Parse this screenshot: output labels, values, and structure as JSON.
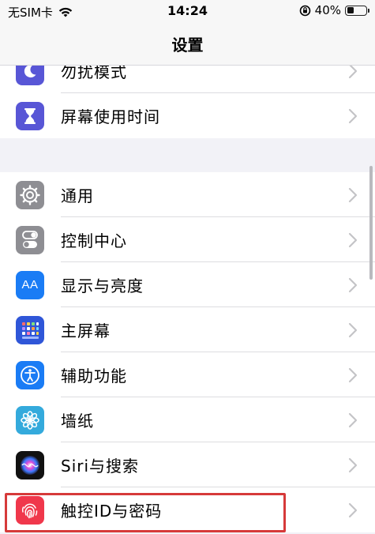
{
  "status_bar": {
    "carrier": "无SIM卡",
    "time": "14:24",
    "battery_percent": "40%",
    "battery_level": 0.4
  },
  "nav": {
    "title": "设置"
  },
  "group1": {
    "items": [
      {
        "label": "勿扰模式",
        "icon": "moon-icon",
        "color": "#5856d6"
      },
      {
        "label": "屏幕使用时间",
        "icon": "hourglass-icon",
        "color": "#5856d6"
      }
    ]
  },
  "group2": {
    "items": [
      {
        "label": "通用",
        "icon": "gear-icon",
        "color": "#8e8e93"
      },
      {
        "label": "控制中心",
        "icon": "toggles-icon",
        "color": "#8e8e93"
      },
      {
        "label": "显示与亮度",
        "icon": "text-size-icon",
        "color": "#1a7cf5"
      },
      {
        "label": "主屏幕",
        "icon": "home-grid-icon",
        "color": "#2f56d8"
      },
      {
        "label": "辅助功能",
        "icon": "accessibility-icon",
        "color": "#1a7cf5"
      },
      {
        "label": "墙纸",
        "icon": "flower-icon",
        "color": "#34aadc"
      },
      {
        "label": "Siri与搜索",
        "icon": "siri-icon",
        "color": "#111111"
      },
      {
        "label": "触控ID与密码",
        "icon": "fingerprint-icon",
        "color": "#f0374b"
      }
    ]
  },
  "icons": {
    "aa_text": "AA"
  },
  "highlight_color": "#d63a3a"
}
